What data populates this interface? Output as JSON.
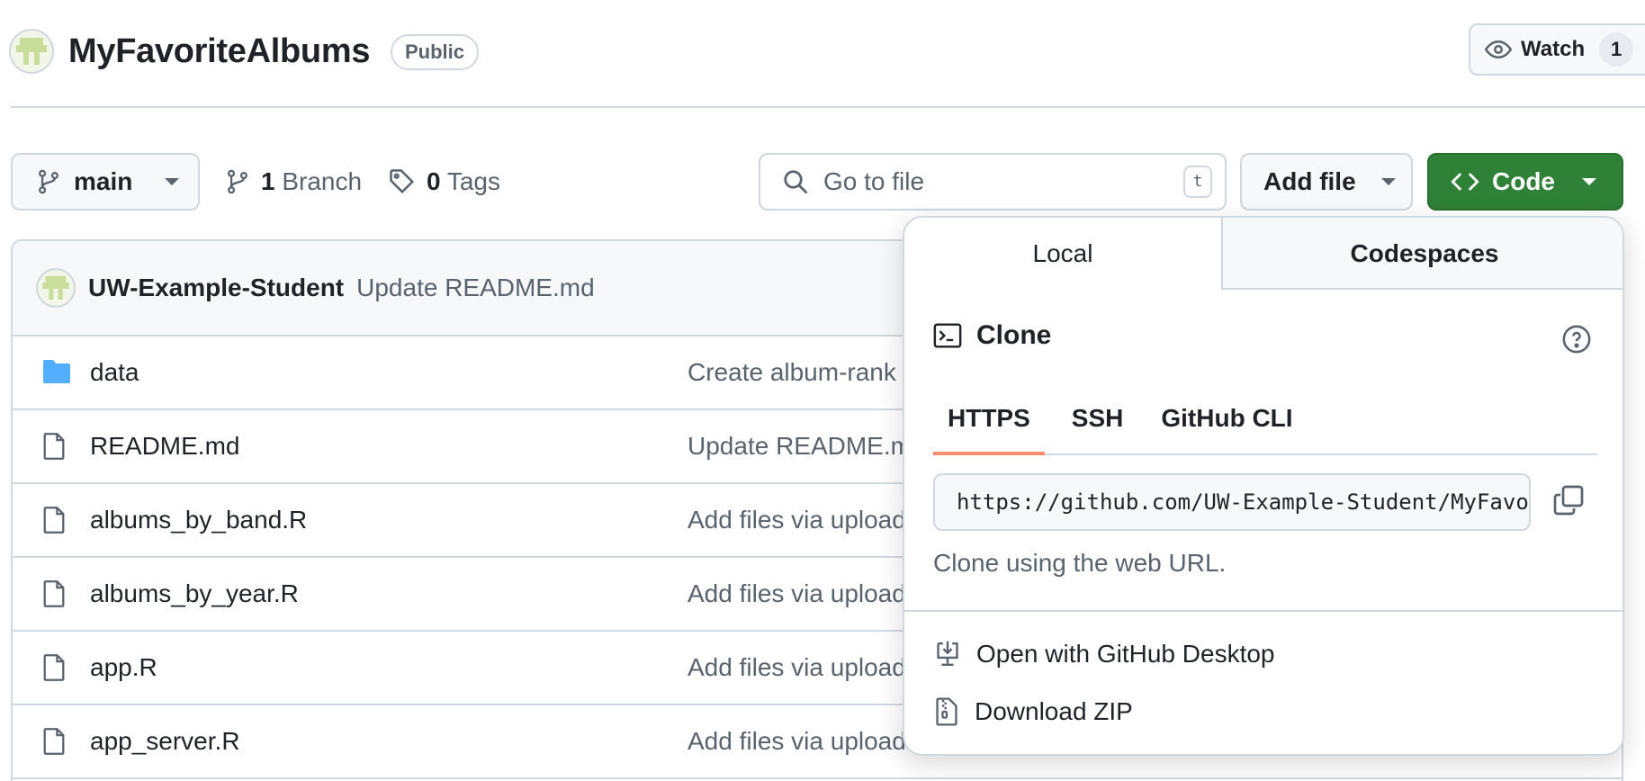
{
  "repo": {
    "name": "MyFavoriteAlbums",
    "visibility": "Public",
    "watch_label": "Watch",
    "watch_count": "1"
  },
  "toolbar": {
    "branch": "main",
    "branch_count": "1",
    "branch_label": "Branch",
    "tag_count": "0",
    "tag_label": "Tags",
    "search_placeholder": "Go to file",
    "search_shortcut": "t",
    "add_file_label": "Add file",
    "code_label": "Code"
  },
  "latest_commit": {
    "author": "UW-Example-Student",
    "message": "Update README.md"
  },
  "files": [
    {
      "name": "data",
      "type": "folder",
      "commit": "Create album-rank"
    },
    {
      "name": "README.md",
      "type": "file",
      "commit": "Update README.m"
    },
    {
      "name": "albums_by_band.R",
      "type": "file",
      "commit": "Add files via upload"
    },
    {
      "name": "albums_by_year.R",
      "type": "file",
      "commit": "Add files via upload"
    },
    {
      "name": "app.R",
      "type": "file",
      "commit": "Add files via upload"
    },
    {
      "name": "app_server.R",
      "type": "file",
      "commit": "Add files via upload"
    }
  ],
  "clone_menu": {
    "tabs": [
      "Local",
      "Codespaces"
    ],
    "active_tab": "Local",
    "section_title": "Clone",
    "protocols": [
      "HTTPS",
      "SSH",
      "GitHub CLI"
    ],
    "active_protocol": "HTTPS",
    "url": "https://github.com/UW-Example-Student/MyFavoriteAlbums.git",
    "hint": "Clone using the web URL.",
    "actions": [
      "Open with GitHub Desktop",
      "Download ZIP"
    ]
  },
  "colors": {
    "code_button": "#2f8137",
    "active_protocol_underline": "#fd8c73",
    "folder_icon": "#54aeff"
  }
}
